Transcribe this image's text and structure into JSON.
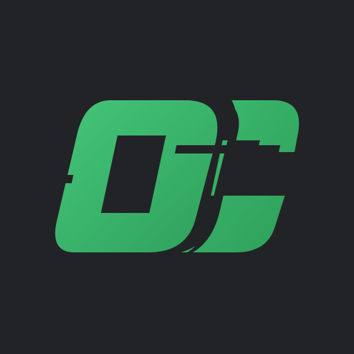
{
  "app_icon": {
    "background_color": "#222327",
    "brand_color": "#3DBC6E",
    "brand_color_light": "#45C67A",
    "brand_color_dark": "#2FA05C",
    "icon_name": "oc-monogram-logo-icon"
  }
}
